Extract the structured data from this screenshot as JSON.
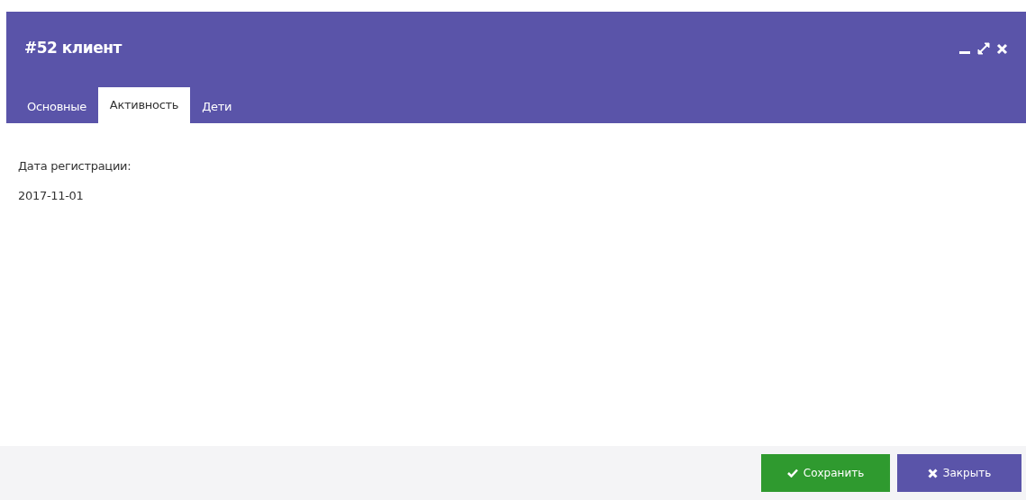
{
  "window": {
    "title": "#52 клиент"
  },
  "tabs": [
    {
      "label": "Основные",
      "selected": false
    },
    {
      "label": "Активность",
      "selected": true
    },
    {
      "label": "Дети",
      "selected": false
    }
  ],
  "fields": [
    {
      "label": "Дата регистрации:",
      "value": "2017-11-01"
    }
  ],
  "buttons": [
    {
      "kind": "save",
      "label": "Сохранить"
    },
    {
      "kind": "close",
      "label": "Закрыть"
    }
  ]
}
